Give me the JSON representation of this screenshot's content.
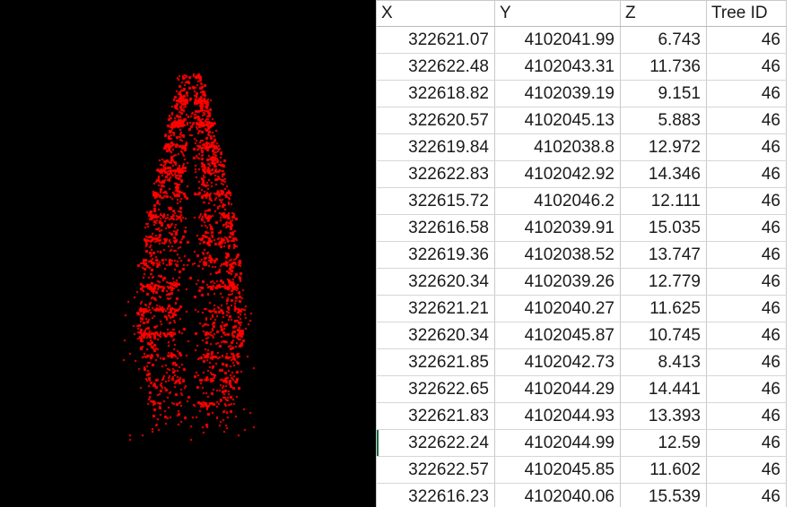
{
  "viewer": {
    "name": "tree-point-cloud-viewport",
    "background_color": "#000000",
    "point_color": "#ff0000",
    "caption": ""
  },
  "table": {
    "columns": [
      {
        "key": "x",
        "label": "X"
      },
      {
        "key": "y",
        "label": "Y"
      },
      {
        "key": "z",
        "label": "Z"
      },
      {
        "key": "id",
        "label": "Tree ID"
      }
    ],
    "selected_row_index": 15,
    "rows": [
      {
        "x": "322621.07",
        "y": "4102041.99",
        "z": "6.743",
        "id": "46"
      },
      {
        "x": "322622.48",
        "y": "4102043.31",
        "z": "11.736",
        "id": "46"
      },
      {
        "x": "322618.82",
        "y": "4102039.19",
        "z": "9.151",
        "id": "46"
      },
      {
        "x": "322620.57",
        "y": "4102045.13",
        "z": "5.883",
        "id": "46"
      },
      {
        "x": "322619.84",
        "y": "4102038.8",
        "z": "12.972",
        "id": "46"
      },
      {
        "x": "322622.83",
        "y": "4102042.92",
        "z": "14.346",
        "id": "46"
      },
      {
        "x": "322615.72",
        "y": "4102046.2",
        "z": "12.111",
        "id": "46"
      },
      {
        "x": "322616.58",
        "y": "4102039.91",
        "z": "15.035",
        "id": "46"
      },
      {
        "x": "322619.36",
        "y": "4102038.52",
        "z": "13.747",
        "id": "46"
      },
      {
        "x": "322620.34",
        "y": "4102039.26",
        "z": "12.779",
        "id": "46"
      },
      {
        "x": "322621.21",
        "y": "4102040.27",
        "z": "11.625",
        "id": "46"
      },
      {
        "x": "322620.34",
        "y": "4102045.87",
        "z": "10.745",
        "id": "46"
      },
      {
        "x": "322621.85",
        "y": "4102042.73",
        "z": "8.413",
        "id": "46"
      },
      {
        "x": "322622.65",
        "y": "4102044.29",
        "z": "14.441",
        "id": "46"
      },
      {
        "x": "322621.83",
        "y": "4102044.93",
        "z": "13.393",
        "id": "46"
      },
      {
        "x": "322622.24",
        "y": "4102044.99",
        "z": "12.59",
        "id": "46"
      },
      {
        "x": "322622.57",
        "y": "4102045.85",
        "z": "11.602",
        "id": "46"
      },
      {
        "x": "322616.23",
        "y": "4102040.06",
        "z": "15.539",
        "id": "46"
      }
    ]
  },
  "chart_data": {
    "type": "scatter",
    "title": "",
    "xlabel": "X",
    "ylabel": "Z",
    "point_color": "#ff0000",
    "background": "#000000",
    "grid": false,
    "legend": null,
    "note": "LiDAR tree point cloud rendered in side elevation; red points on black background",
    "sampled_points": [
      {
        "x": "322621.07",
        "y": "4102041.99",
        "z": "6.743"
      },
      {
        "x": "322622.48",
        "y": "4102043.31",
        "z": "11.736"
      },
      {
        "x": "322618.82",
        "y": "4102039.19",
        "z": "9.151"
      },
      {
        "x": "322620.57",
        "y": "4102045.13",
        "z": "5.883"
      },
      {
        "x": "322619.84",
        "y": "4102038.8",
        "z": "12.972"
      },
      {
        "x": "322622.83",
        "y": "4102042.92",
        "z": "14.346"
      },
      {
        "x": "322615.72",
        "y": "4102046.2",
        "z": "12.111"
      },
      {
        "x": "322616.58",
        "y": "4102039.91",
        "z": "15.035"
      },
      {
        "x": "322619.36",
        "y": "4102038.52",
        "z": "13.747"
      },
      {
        "x": "322620.34",
        "y": "4102039.26",
        "z": "12.779"
      },
      {
        "x": "322621.21",
        "y": "4102040.27",
        "z": "11.625"
      },
      {
        "x": "322620.34",
        "y": "4102045.87",
        "z": "10.745"
      },
      {
        "x": "322621.85",
        "y": "4102042.73",
        "z": "8.413"
      },
      {
        "x": "322622.65",
        "y": "4102044.29",
        "z": "14.441"
      },
      {
        "x": "322621.83",
        "y": "4102044.93",
        "z": "13.393"
      },
      {
        "x": "322622.24",
        "y": "4102044.99",
        "z": "12.59"
      },
      {
        "x": "322622.57",
        "y": "4102045.85",
        "z": "11.602"
      },
      {
        "x": "322616.23",
        "y": "4102040.06",
        "z": "15.539"
      }
    ]
  }
}
